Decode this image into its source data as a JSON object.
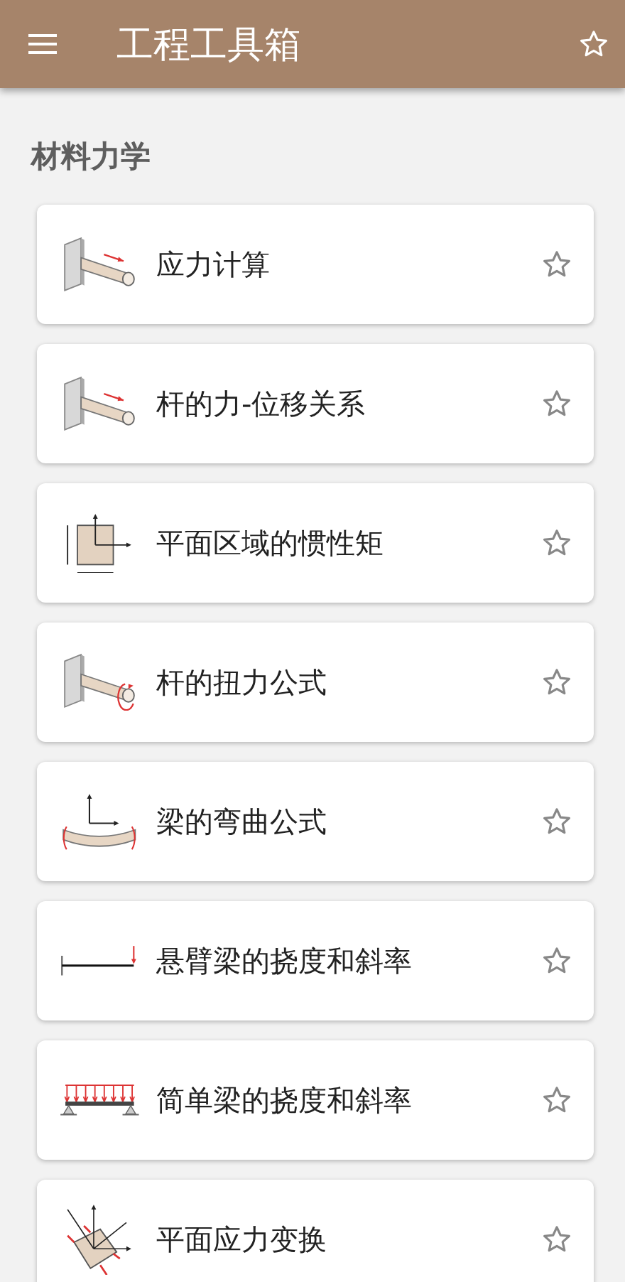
{
  "app_bar": {
    "title": "工程工具箱",
    "favorite": false
  },
  "section": {
    "title": "材料力学"
  },
  "items": [
    {
      "label": "应力计算",
      "kind": "rod-axial",
      "favorite": false
    },
    {
      "label": "杆的力-位移关系",
      "kind": "rod-axial",
      "favorite": false
    },
    {
      "label": "平面区域的惯性矩",
      "kind": "rectangle-section",
      "favorite": false
    },
    {
      "label": "杆的扭力公式",
      "kind": "rod-torsion",
      "favorite": false
    },
    {
      "label": "梁的弯曲公式",
      "kind": "beam-bending",
      "favorite": false
    },
    {
      "label": "悬臂梁的挠度和斜率",
      "kind": "cantilever",
      "favorite": false
    },
    {
      "label": "简单梁的挠度和斜率",
      "kind": "simple-beam",
      "favorite": false
    },
    {
      "label": "平面应力变换",
      "kind": "stress-element",
      "favorite": false
    }
  ]
}
